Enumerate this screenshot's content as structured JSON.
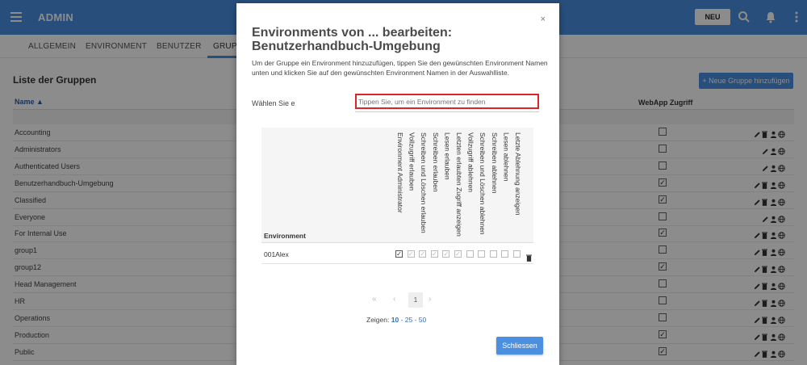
{
  "app": {
    "title": "ADMIN",
    "new_label": "NEU"
  },
  "tabs": [
    "ALLGEMEIN",
    "ENVIRONMENT",
    "BENUTZER",
    "GRUPP"
  ],
  "page": {
    "title": "Liste der Gruppen",
    "new_group_button": "+ Neue Gruppe hinzufügen",
    "col_name": "Name ▲",
    "col_webapp": "WebApp Zugriff"
  },
  "groups": [
    {
      "name": "Accounting",
      "webapp": false,
      "delete": true
    },
    {
      "name": "Administrators",
      "webapp": false,
      "delete": false
    },
    {
      "name": "Authenticated Users",
      "webapp": false,
      "delete": false
    },
    {
      "name": "Benutzerhandbuch-Umgebung",
      "webapp": true,
      "delete": true
    },
    {
      "name": "Classified",
      "webapp": true,
      "delete": true
    },
    {
      "name": "Everyone",
      "webapp": false,
      "delete": false
    },
    {
      "name": "For Internal Use",
      "webapp": true,
      "delete": true
    },
    {
      "name": "group1",
      "webapp": false,
      "delete": true
    },
    {
      "name": "group12",
      "webapp": true,
      "delete": true
    },
    {
      "name": "Head Management",
      "webapp": false,
      "delete": true
    },
    {
      "name": "HR",
      "webapp": false,
      "delete": true
    },
    {
      "name": "Operations",
      "webapp": false,
      "delete": true
    },
    {
      "name": "Production",
      "webapp": true,
      "delete": true
    },
    {
      "name": "Public",
      "webapp": true,
      "delete": true
    }
  ],
  "modal": {
    "close": "×",
    "title": "Environments von ... bearbeiten: Benutzerhandbuch-Umgebung",
    "description": "Um der Gruppe ein Environment hinzuzufügen, tippen Sie den gewünschten Environment Namen unten und klicken Sie auf den gewünschten Environment Namen in der Auswahlliste.",
    "select_label": "Wählen Sie e",
    "input_placeholder": "Tippen Sie, um ein Environment zu finden",
    "table": {
      "col_environment": "Environment",
      "perm_columns": [
        "Environment Administrator",
        "Vollzugriff erlauben",
        "Schreiben und Löschen erlauben",
        "Schreiben erlauben",
        "Lesen erlauben",
        "Letzten erlaubten Zugriff anzeigen",
        "Vollzugriff ablehnen",
        "Schreiben und Löschen ablehnen",
        "Schreiben ablehnen",
        "Lesen ablehnen",
        "Letzte Ablehnung anzeigen"
      ],
      "rows": [
        {
          "name": "001Alex",
          "perms": [
            true,
            true,
            true,
            true,
            true,
            true,
            false,
            false,
            false,
            false,
            false
          ]
        }
      ]
    },
    "pager": {
      "first": "«",
      "prev": "‹",
      "current": "1",
      "next": "›"
    },
    "show": {
      "label": "Zeigen:",
      "opt1": "10",
      "sep1": " - ",
      "opt2": "25",
      "sep2": " - ",
      "opt3": "50"
    },
    "close_button": "Schliessen"
  }
}
